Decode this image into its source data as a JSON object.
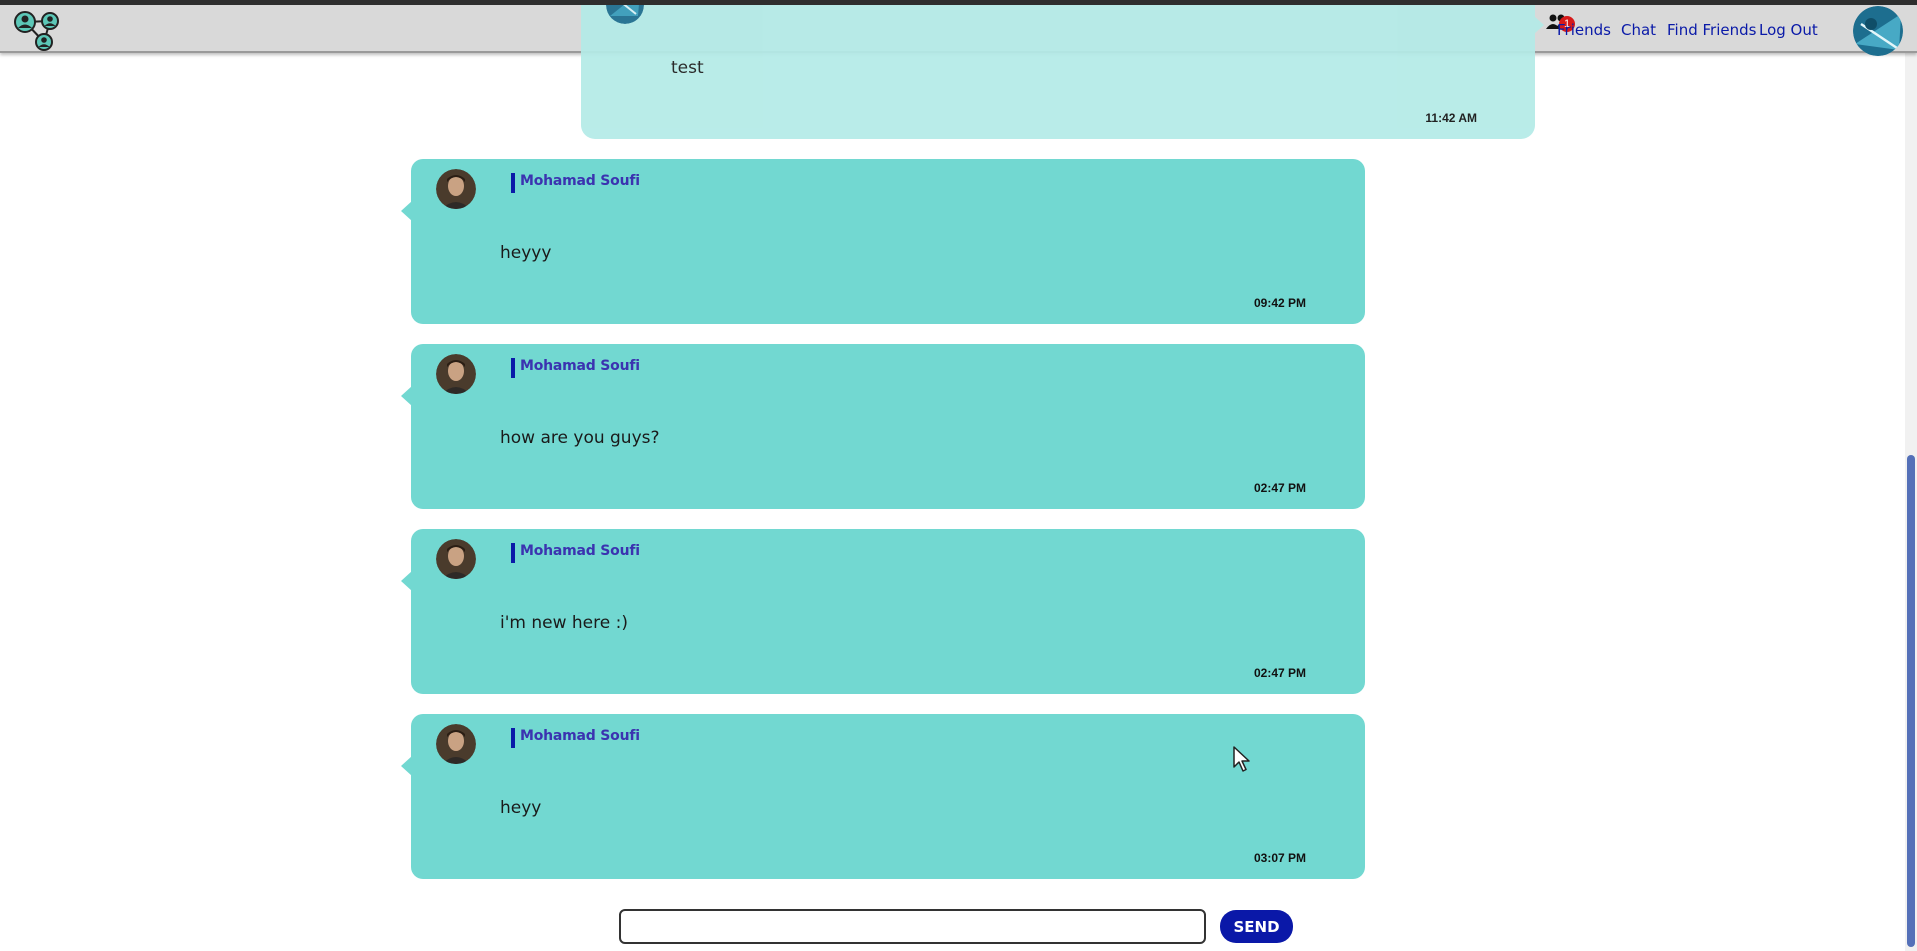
{
  "nav": {
    "links": [
      "Friends",
      "Chat",
      "Find Friends",
      "Log Out"
    ],
    "friend_request_badge": "1"
  },
  "self_message": {
    "text": "test",
    "time": "11:42 AM"
  },
  "messages": [
    {
      "author": "Mohamad Soufi",
      "text": "heyyy",
      "time": "09:42 PM"
    },
    {
      "author": "Mohamad Soufi",
      "text": "how are you guys?",
      "time": "02:47 PM"
    },
    {
      "author": "Mohamad Soufi",
      "text": "i'm new here :)",
      "time": "02:47 PM"
    },
    {
      "author": "Mohamad Soufi",
      "text": "heyy",
      "time": "03:07 PM"
    }
  ],
  "composer": {
    "value": "",
    "send_label": "SEND"
  },
  "colors": {
    "accent": "#0a18a8",
    "bubble": "#72d8d1",
    "bubble_self": "#b4ebe7",
    "nav_bg": "#d9d9d9",
    "badge": "#d71a1a"
  }
}
